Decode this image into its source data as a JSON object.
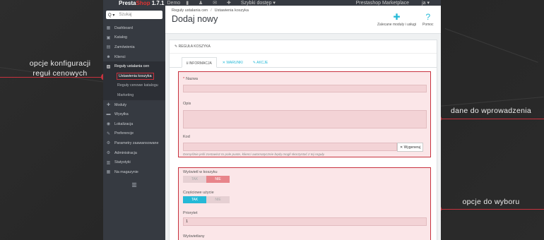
{
  "topbar": {
    "logo_a": "Presta",
    "logo_b": "Shop",
    "version": "1.7.1",
    "demo": "Demo",
    "icons": "▮ ♟ ✉ ✚",
    "quick": "Szybki dostęp ▾",
    "market": "Prestashop Marketplace",
    "user": "ja ▾"
  },
  "search": {
    "icon": "Q ▾",
    "placeholder": "Szukaj"
  },
  "nav": {
    "dashboard": {
      "icon": "▦",
      "label": "Dashboard"
    },
    "catalog": {
      "icon": "▣",
      "label": "Katalog"
    },
    "orders": {
      "icon": "▤",
      "label": "Zamówienia"
    },
    "customers": {
      "icon": "☻",
      "label": "Klienci"
    },
    "price_rules": {
      "icon": "▨",
      "label": "Reguły ustalania cen"
    },
    "sub_cart": "Ustawienia koszyka",
    "sub_catalog": "Reguły cenowe katalogu",
    "sub_marketing": "Marketing",
    "modules": {
      "icon": "✚",
      "label": "Moduły"
    },
    "shipping": {
      "icon": "▬",
      "label": "Wysyłka"
    },
    "localization": {
      "icon": "◉",
      "label": "Lokalizacja"
    },
    "preferences": {
      "icon": "✎",
      "label": "Preferencje"
    },
    "advanced": {
      "icon": "⚙",
      "label": "Parametry zaawansowane"
    },
    "admin": {
      "icon": "⚙",
      "label": "Administracja"
    },
    "stats": {
      "icon": "▥",
      "label": "Statystyki"
    },
    "stock": {
      "icon": "▦",
      "label": "Na magazynie"
    },
    "toggle": "▥"
  },
  "header": {
    "crumb1": "Reguły ustalania cen",
    "crumb_sep": "/",
    "crumb2": "Ustawienia koszyka",
    "title": "Dodaj nowy",
    "tool1_icon": "✚",
    "tool1": "Zalecane moduły i usługi",
    "tool2_icon": "?",
    "tool2": "Pomoc"
  },
  "panel": {
    "heading": "✎ REGUŁA KOSZYKA",
    "tab_info": "ℹ INFORMACJA",
    "tab_conditions": "✕ WARUNKI",
    "tab_actions": "✎ AKCJE"
  },
  "form": {
    "req_mark": "*",
    "name_label": "Nazwa",
    "desc_label": "Opis",
    "code_label": "Kod",
    "generate": "✕ Wygeneruj",
    "code_help": "Domyślnie jeśli zostawisz to pole puste, klienci automatycznie będą mogli skorzystać z tej reguły.",
    "highlight_label": "Wyświetl w koszyku",
    "partial_label": "Częściowe użycie",
    "priority_label": "Priorytet",
    "priority_value": "1",
    "status_label": "Wyświetlany",
    "yes": "TAK",
    "no": "NIE"
  },
  "annotations": {
    "left_line1": "opcje konfiguracji",
    "left_line2": "reguł cenowych",
    "right_top": "dane do wprowadzenia",
    "right_bottom": "opcje do wyboru",
    "marker": "›"
  }
}
